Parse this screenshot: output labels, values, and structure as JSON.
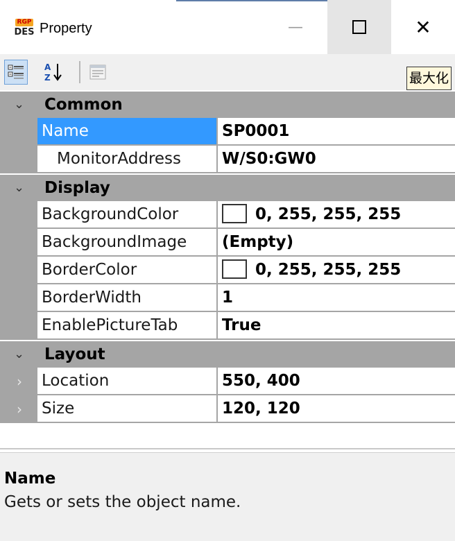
{
  "window": {
    "icon_top": "RGP",
    "icon_bottom": "DES",
    "title": "Property",
    "minimize_glyph": "—",
    "close_glyph": "✕"
  },
  "toolbar": {
    "categorized_icon": "categorized-view-icon",
    "alphabetical_icon": "sort-az-icon",
    "property_pages_icon": "property-pages-icon",
    "maximize_label": "最大化"
  },
  "grid": {
    "categories": [
      {
        "label": "Common",
        "properties": [
          {
            "name": "Name",
            "value": "SP0001",
            "selected": true
          },
          {
            "name": "MonitorAddress",
            "value": "W/S0:GW0",
            "indent": true
          }
        ]
      },
      {
        "label": "Display",
        "properties": [
          {
            "name": "BackgroundColor",
            "value": "0, 255, 255, 255",
            "swatch": "#ffffff"
          },
          {
            "name": "BackgroundImage",
            "value": "(Empty)"
          },
          {
            "name": "BorderColor",
            "value": "0, 255, 255, 255",
            "swatch": "#ffffff"
          },
          {
            "name": "BorderWidth",
            "value": "1"
          },
          {
            "name": "EnablePictureTab",
            "value": "True"
          }
        ]
      },
      {
        "label": "Layout",
        "properties": [
          {
            "name": "Location",
            "value": "550, 400",
            "expandable": true
          },
          {
            "name": "Size",
            "value": "120, 120",
            "expandable": true
          }
        ]
      }
    ],
    "category_chevron": "⌄",
    "expand_chevron": "›"
  },
  "description": {
    "title": "Name",
    "text": "Gets or sets the object name."
  },
  "colors": {
    "selection": "#3399ff",
    "category_band": "#a5a5a5",
    "toolbar_bg": "#f0f0f0"
  }
}
